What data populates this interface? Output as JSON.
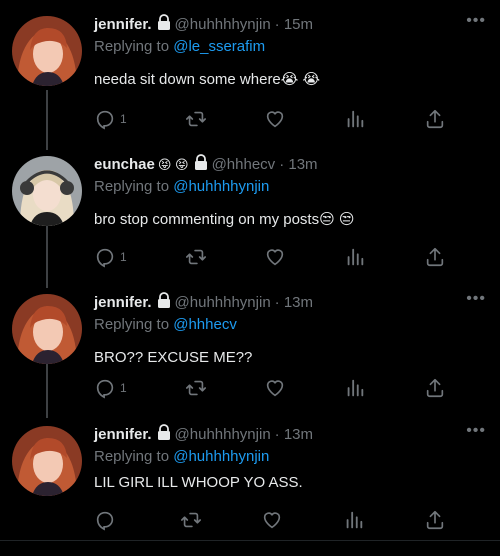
{
  "tweets": [
    {
      "name": "jennifer.",
      "emojis": "",
      "handle": "@huhhhhynjin",
      "time": "· 15m",
      "reply_prefix": "Replying to",
      "reply_to": "@le_sserafim",
      "text": "needa sit down some where😭 😭",
      "reply_count": "1"
    },
    {
      "name": "eunchae",
      "emojis": "😝 😝",
      "handle": "@hhhecv",
      "time": "· 13m",
      "reply_prefix": "Replying to",
      "reply_to": "@huhhhhynjin",
      "text": "bro stop commenting on my posts😒 😒",
      "reply_count": "1"
    },
    {
      "name": "jennifer.",
      "emojis": "",
      "handle": "@huhhhhynjin",
      "time": "· 13m",
      "reply_prefix": "Replying to",
      "reply_to": "@hhhecv",
      "text": "BRO?? EXCUSE ME??",
      "reply_count": "1"
    },
    {
      "name": "jennifer.",
      "emojis": "",
      "handle": "@huhhhhynjin",
      "time": "· 13m",
      "reply_prefix": "Replying to",
      "reply_to": "@huhhhhynjin",
      "text": "LIL GIRL ILL WHOOP YO ASS.",
      "reply_count": ""
    }
  ],
  "more_label": "•••",
  "icons": {
    "reply": "reply-icon",
    "retweet": "retweet-icon",
    "like": "heart-icon",
    "analytics": "analytics-icon",
    "share": "share-icon",
    "lock": "lock-icon",
    "more": "more-icon"
  }
}
